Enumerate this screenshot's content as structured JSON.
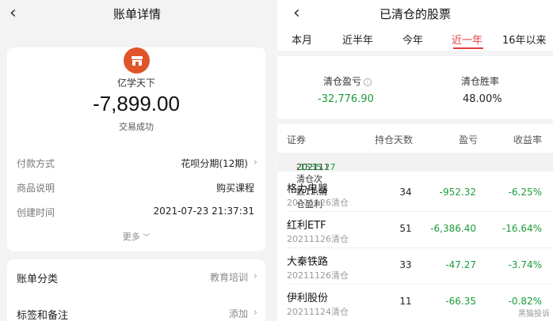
{
  "left": {
    "title": "账单详情",
    "merchant": "亿学天下",
    "amount": "-7,899.00",
    "status": "交易成功",
    "details": [
      {
        "label": "付款方式",
        "value": "花呗分期(12期)"
      },
      {
        "label": "商品说明",
        "value": "购买课程"
      },
      {
        "label": "创建时间",
        "value": "2021-07-23 21:37:31"
      }
    ],
    "more": "更多",
    "category": {
      "label": "账单分类",
      "value": "教育培训"
    },
    "tags": {
      "label": "标签和备注",
      "value": "添加"
    }
  },
  "right": {
    "title": "已清仓的股票",
    "tabs": [
      "本月",
      "近半年",
      "今年",
      "近一年",
      "16年以来"
    ],
    "active_tab": "近一年",
    "summary": {
      "pnl_label": "清仓盈亏",
      "pnl_value": "-32,776.90",
      "win_label": "清仓胜率",
      "win_value": "48.00%"
    },
    "columns": [
      "证券",
      "持仓天数",
      "盈亏",
      "收益率"
    ],
    "group": {
      "text": "202111清仓次数12,清仓盈利",
      "value": "-1535.27"
    },
    "rows": [
      {
        "name": "格力电器",
        "date": "20211126清仓",
        "days": "34",
        "pnl": "-952.32",
        "rate": "-6.25%"
      },
      {
        "name": "红利ETF",
        "date": "20211126清仓",
        "days": "51",
        "pnl": "-6,386.40",
        "rate": "-16.64%"
      },
      {
        "name": "大秦铁路",
        "date": "20211126清仓",
        "days": "33",
        "pnl": "-47.27",
        "rate": "-3.74%"
      },
      {
        "name": "伊利股份",
        "date": "20211124清仓",
        "days": "11",
        "pnl": "-66.35",
        "rate": "-0.82%"
      }
    ],
    "watermark": "黑猫投诉"
  },
  "colors": {
    "accent": "#e43d3d",
    "loss_green": "#1a9b3a",
    "shop_orange": "#e0542a"
  }
}
